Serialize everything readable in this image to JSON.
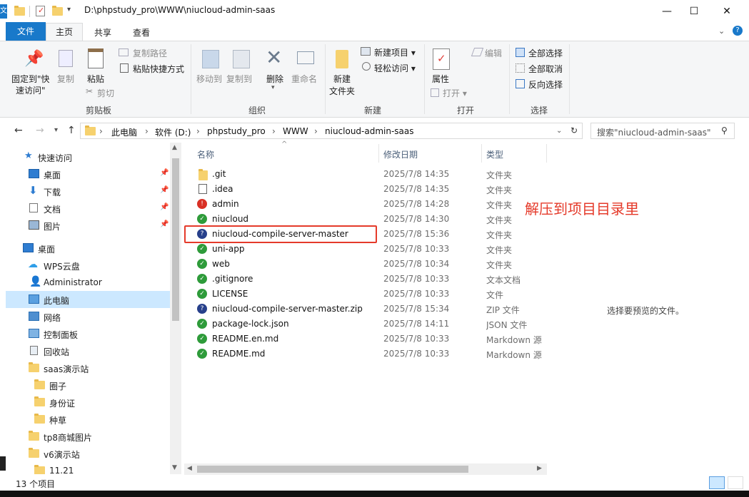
{
  "window": {
    "title": "D:\\phpstudy_pro\\WWW\\niucloud-admin-saas",
    "app_initial": "文",
    "minimize": "—",
    "maximize": "☐",
    "close": "✕"
  },
  "tabs": [
    "文件",
    "主页",
    "共享",
    "查看"
  ],
  "ribbon": {
    "pin": "固定到\"快",
    "pin2": "速访问\"",
    "copy": "复制",
    "paste": "粘贴",
    "copy_path": "复制路径",
    "paste_shortcut": "粘贴快捷方式",
    "cut": "剪切",
    "clipboard": "剪贴板",
    "move_to": "移动到",
    "copy_to": "复制到",
    "delete": "删除",
    "rename": "重命名",
    "organize": "组织",
    "new_folder": "新建",
    "new_folder2": "文件夹",
    "new_item": "新建项目 ▾",
    "easy_access": "轻松访问 ▾",
    "new": "新建",
    "properties": "属性",
    "open": "打开 ▾",
    "edit": "编辑",
    "open_group": "打开",
    "select_all": "全部选择",
    "select_none": "全部取消",
    "invert": "反向选择",
    "select": "选择"
  },
  "address": {
    "crumbs": [
      "此电脑",
      "软件 (D:)",
      "phpstudy_pro",
      "WWW",
      "niucloud-admin-saas"
    ],
    "search_placeholder": "搜索\"niucloud-admin-saas\""
  },
  "sidebar": {
    "items": [
      {
        "label": "快速访问"
      },
      {
        "label": "桌面"
      },
      {
        "label": "下载"
      },
      {
        "label": "文档"
      },
      {
        "label": "图片"
      },
      {
        "label": "桌面"
      },
      {
        "label": "WPS云盘"
      },
      {
        "label": "Administrator"
      },
      {
        "label": "此电脑"
      },
      {
        "label": "网络"
      },
      {
        "label": "控制面板"
      },
      {
        "label": "回收站"
      },
      {
        "label": "saas演示站"
      },
      {
        "label": "圈子"
      },
      {
        "label": "身份证"
      },
      {
        "label": "种草"
      },
      {
        "label": "tp8商城图片"
      },
      {
        "label": "v6演示站"
      },
      {
        "label": "11.21"
      }
    ]
  },
  "columns": {
    "name": "名称",
    "date": "修改日期",
    "type": "类型"
  },
  "files": [
    {
      "name": ".git",
      "date": "2025/7/8 14:35",
      "type": "文件夹"
    },
    {
      "name": ".idea",
      "date": "2025/7/8 14:35",
      "type": "文件夹"
    },
    {
      "name": "admin",
      "date": "2025/7/8 14:28",
      "type": "文件夹"
    },
    {
      "name": "niucloud",
      "date": "2025/7/8 14:30",
      "type": "文件夹"
    },
    {
      "name": "niucloud-compile-server-master",
      "date": "2025/7/8 15:36",
      "type": "文件夹"
    },
    {
      "name": "uni-app",
      "date": "2025/7/8 10:33",
      "type": "文件夹"
    },
    {
      "name": "web",
      "date": "2025/7/8 10:34",
      "type": "文件夹"
    },
    {
      "name": ".gitignore",
      "date": "2025/7/8 10:33",
      "type": "文本文档"
    },
    {
      "name": "LICENSE",
      "date": "2025/7/8 10:33",
      "type": "文件"
    },
    {
      "name": "niucloud-compile-server-master.zip",
      "date": "2025/7/8 15:34",
      "type": "ZIP 文件"
    },
    {
      "name": "package-lock.json",
      "date": "2025/7/8 14:11",
      "type": "JSON 文件"
    },
    {
      "name": "README.en.md",
      "date": "2025/7/8 10:33",
      "type": "Markdown 源"
    },
    {
      "name": "README.md",
      "date": "2025/7/8 10:33",
      "type": "Markdown 源"
    }
  ],
  "annotation": "解压到项目目录里",
  "preview_message": "选择要预览的文件。",
  "status": {
    "count": "13 个项目"
  }
}
